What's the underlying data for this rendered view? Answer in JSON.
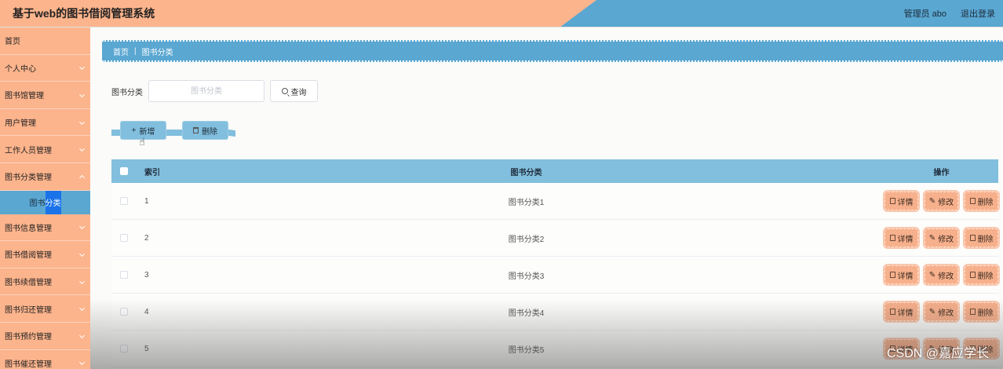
{
  "header": {
    "title": "基于web的图书借阅管理系统",
    "user": "管理员 abo",
    "logout": "退出登录",
    "colors": {
      "orange": "#fcb48c",
      "blue": "#5aa7d2"
    }
  },
  "sidebar": {
    "items": [
      {
        "label": "首页"
      },
      {
        "label": "个人中心"
      },
      {
        "label": "图书馆管理"
      },
      {
        "label": "用户管理"
      },
      {
        "label": "工作人员管理"
      },
      {
        "label": "图书分类管理"
      },
      {
        "label": "图书信息管理"
      },
      {
        "label": "图书借阅管理"
      },
      {
        "label": "图书续借管理"
      },
      {
        "label": "图书归还管理"
      },
      {
        "label": "图书预约管理"
      },
      {
        "label": "图书催还管理"
      }
    ],
    "active_sub_pre": "图书",
    "active_sub_hl": "分类"
  },
  "breadcrumb": {
    "home": "首页",
    "current": "图书分类"
  },
  "search": {
    "label": "图书分类",
    "placeholder": "图书分类",
    "button": "查询"
  },
  "actions": {
    "add": "新增",
    "delete": "删除"
  },
  "table": {
    "headers": {
      "index": "索引",
      "category": "图书分类",
      "ops": "操作"
    },
    "rows": [
      {
        "index": "1",
        "category": "图书分类1"
      },
      {
        "index": "2",
        "category": "图书分类2"
      },
      {
        "index": "3",
        "category": "图书分类3"
      },
      {
        "index": "4",
        "category": "图书分类4"
      },
      {
        "index": "5",
        "category": "图书分类5"
      }
    ],
    "row_ops": {
      "detail": "详情",
      "edit": "修改",
      "delete": "删除"
    }
  },
  "watermark": "CSDN @嘉应学长"
}
